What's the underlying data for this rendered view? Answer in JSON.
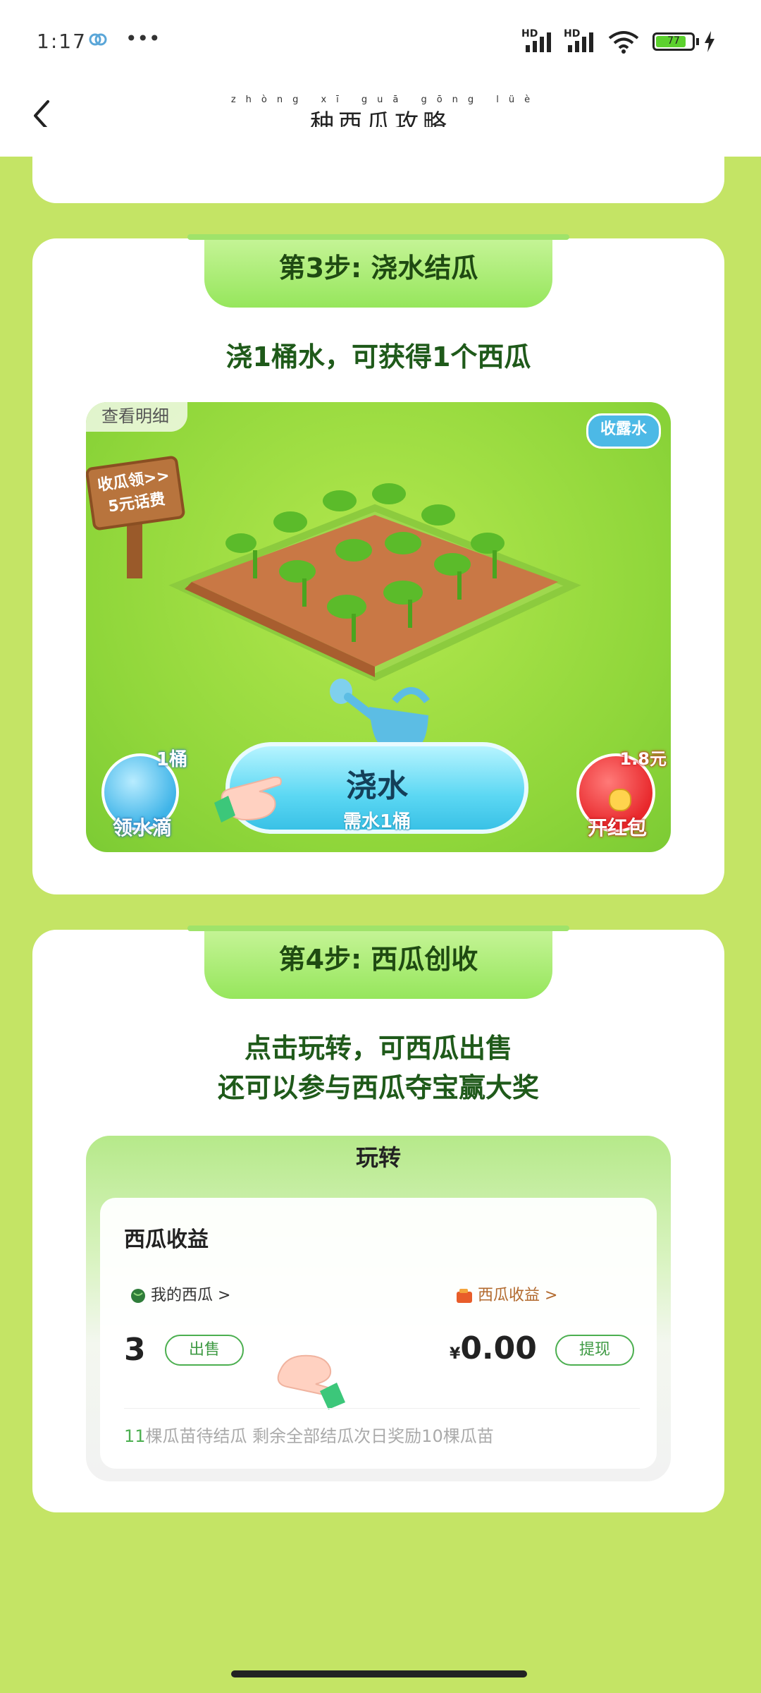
{
  "status_bar": {
    "time": "1:17",
    "dots": "•••",
    "sim1": "HD",
    "sim2": "HD",
    "battery": "77"
  },
  "header": {
    "title_pinyin": "zhòng xī guā gōng lüè",
    "title": "种西瓜攻略"
  },
  "step3": {
    "tab": "第3步: 浇水结瓜",
    "subtitle": "浇1桶水，可获得1个西瓜",
    "scene": {
      "detail_link": "查看明细",
      "dew_button": "收露水",
      "sign_text_line1": "收瓜领>>",
      "sign_text_line2": "5元话费",
      "water_button": "浇水",
      "water_sub": "需水1桶",
      "drop_badge": "1桶",
      "drop_label": "领水滴",
      "red_badge": "1.8元",
      "red_label": "开红包"
    }
  },
  "step4": {
    "tab": "第4步: 西瓜创收",
    "subtitle_line1": "点击玩转，可西瓜出售",
    "subtitle_line2": "还可以参与西瓜夺宝赢大奖",
    "panel": {
      "title": "玩转",
      "income_title": "西瓜收益",
      "my_melons_link": "我的西瓜 >",
      "income_link": "西瓜收益 >",
      "melon_count": "3",
      "sell_button": "出售",
      "money_symbol": "¥",
      "money_value": "0.00",
      "withdraw_button": "提现",
      "note_count": "11",
      "note_text": "棵瓜苗待结瓜  剩余全部结瓜次日奖励10棵瓜苗"
    }
  },
  "colors": {
    "page_bg": "#c4e465",
    "tab_green": "#96e65c",
    "title_green": "#1f5a1a",
    "water_blue": "#39c1e6",
    "red_packet": "#e8282c"
  }
}
